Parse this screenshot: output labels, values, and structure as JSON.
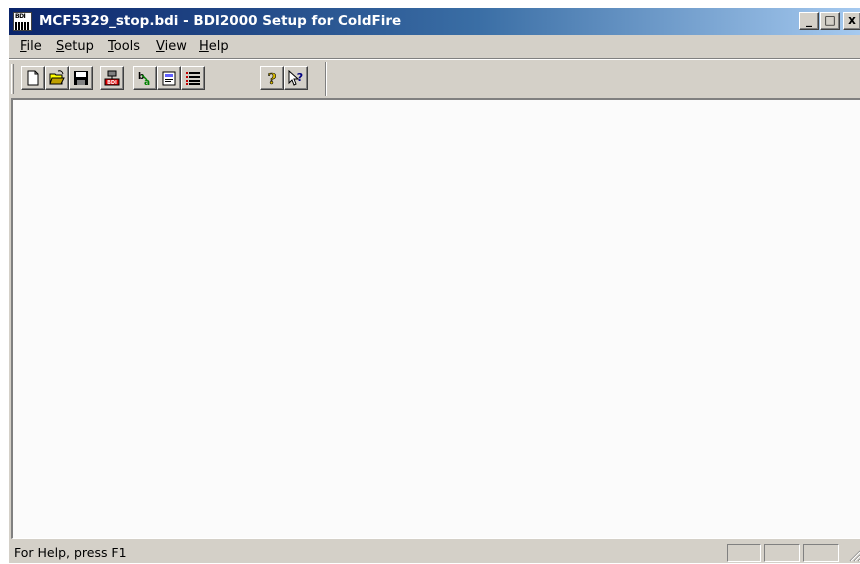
{
  "window": {
    "title": "MCF5329_stop.bdi - BDI2000 Setup for ColdFire",
    "app_icon_text": "BDI"
  },
  "caption_buttons": {
    "minimize": "_",
    "maximize": "□",
    "close": "x"
  },
  "menu": {
    "items": [
      {
        "label_ul": "F",
        "label_rest": "ile"
      },
      {
        "label_ul": "S",
        "label_rest": "etup"
      },
      {
        "label_ul": "T",
        "label_rest": "ools"
      },
      {
        "label_ul": "V",
        "label_rest": "iew"
      },
      {
        "label_ul": "H",
        "label_rest": "elp"
      }
    ]
  },
  "toolbar": {
    "buttons": [
      {
        "icon": "new-file-icon"
      },
      {
        "icon": "open-folder-icon"
      },
      {
        "icon": "save-icon"
      },
      {
        "icon": "bdi-target-icon",
        "text": "BDI"
      },
      {
        "icon": "connect-icon"
      },
      {
        "icon": "document-icon"
      },
      {
        "icon": "config-list-icon"
      },
      {
        "icon": "help-icon"
      },
      {
        "icon": "context-help-icon"
      }
    ]
  },
  "status": {
    "text": "For Help, press F1"
  },
  "colors": {
    "title_start": "#0a246a",
    "title_end": "#a6caf0",
    "face": "#d4d0c8",
    "client": "#fbfbfb"
  }
}
